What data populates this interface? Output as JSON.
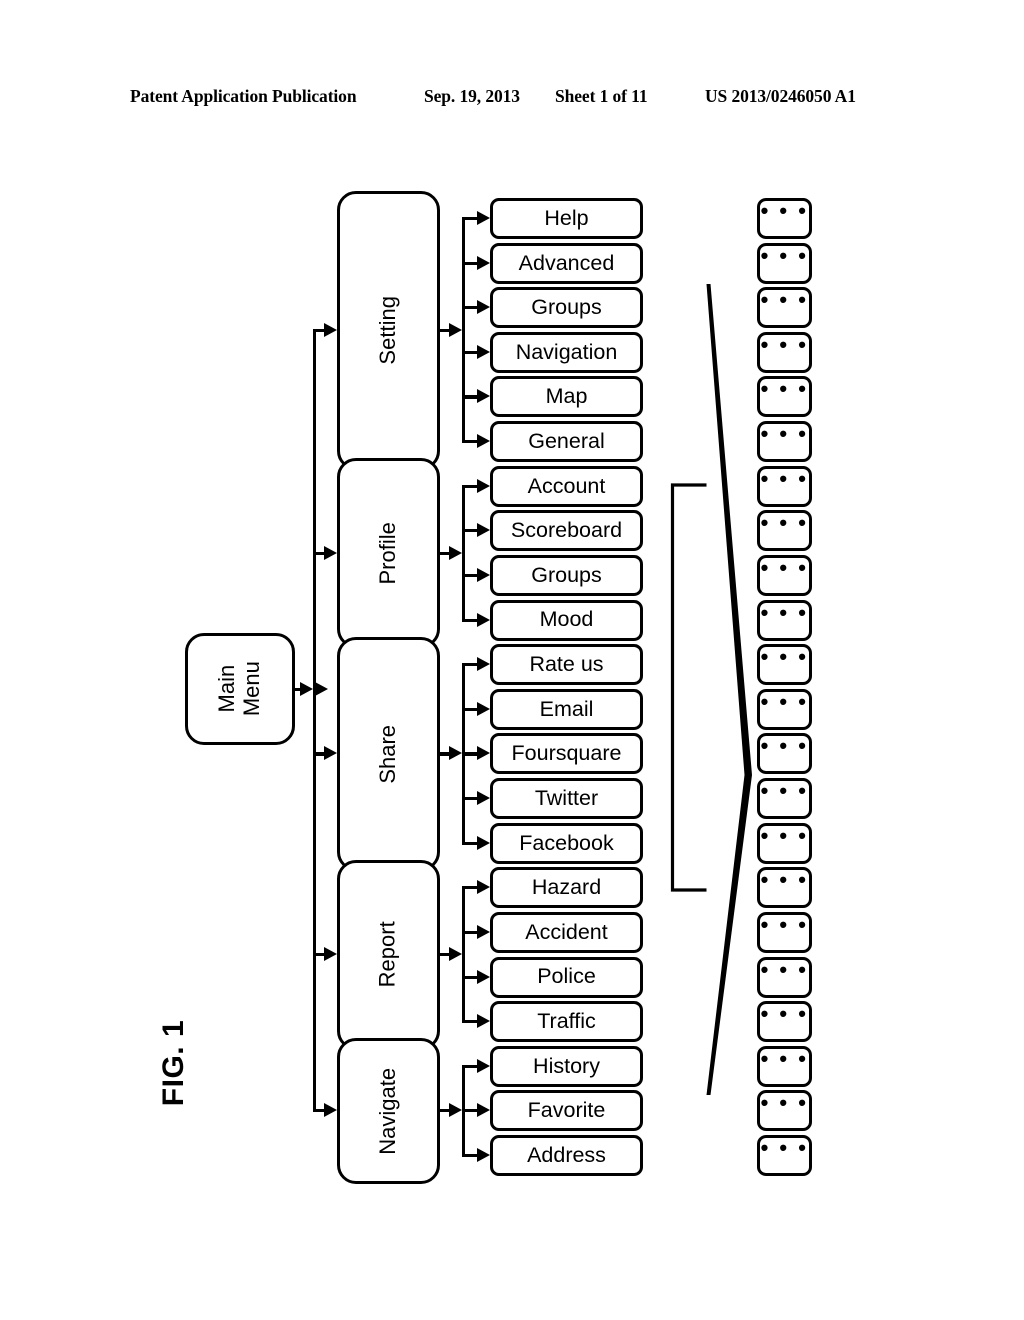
{
  "header": {
    "publication": "Patent Application Publication",
    "date": "Sep. 19, 2013",
    "sheet": "Sheet 1 of 11",
    "number": "US 2013/0246050 A1"
  },
  "figure": {
    "label": "FIG. 1",
    "root": {
      "label": "Main\nMenu",
      "name": "main-menu"
    },
    "ellipsis": "• • •",
    "categories": [
      {
        "label": "Setting",
        "name": "setting",
        "children": [
          "Help",
          "Advanced",
          "Groups",
          "Navigation",
          "Map",
          "General"
        ]
      },
      {
        "label": "Profile",
        "name": "profile",
        "children": [
          "Account",
          "Scoreboard",
          "Groups",
          "Mood"
        ]
      },
      {
        "label": "Share",
        "name": "share",
        "children": [
          "Rate us",
          "Email",
          "Foursquare",
          "Twitter",
          "Facebook"
        ]
      },
      {
        "label": "Report",
        "name": "report",
        "children": [
          "Hazard",
          "Accident",
          "Police",
          "Traffic"
        ]
      },
      {
        "label": "Navigate",
        "name": "navigate",
        "children": [
          "History",
          "Favorite",
          "Address"
        ]
      }
    ],
    "leaf_items": [
      "Help",
      "Advanced",
      "Groups",
      "Navigation",
      "Map",
      "General",
      "Account",
      "Scoreboard",
      "Groups",
      "Mood",
      "Rate us",
      "Email",
      "Foursquare",
      "Twitter",
      "Facebook",
      "Hazard",
      "Accident",
      "Police",
      "Traffic",
      "History",
      "Favorite",
      "Address"
    ],
    "detail_column_count": 22,
    "colors": {
      "line": "#000000",
      "fill": "#ffffff"
    }
  }
}
